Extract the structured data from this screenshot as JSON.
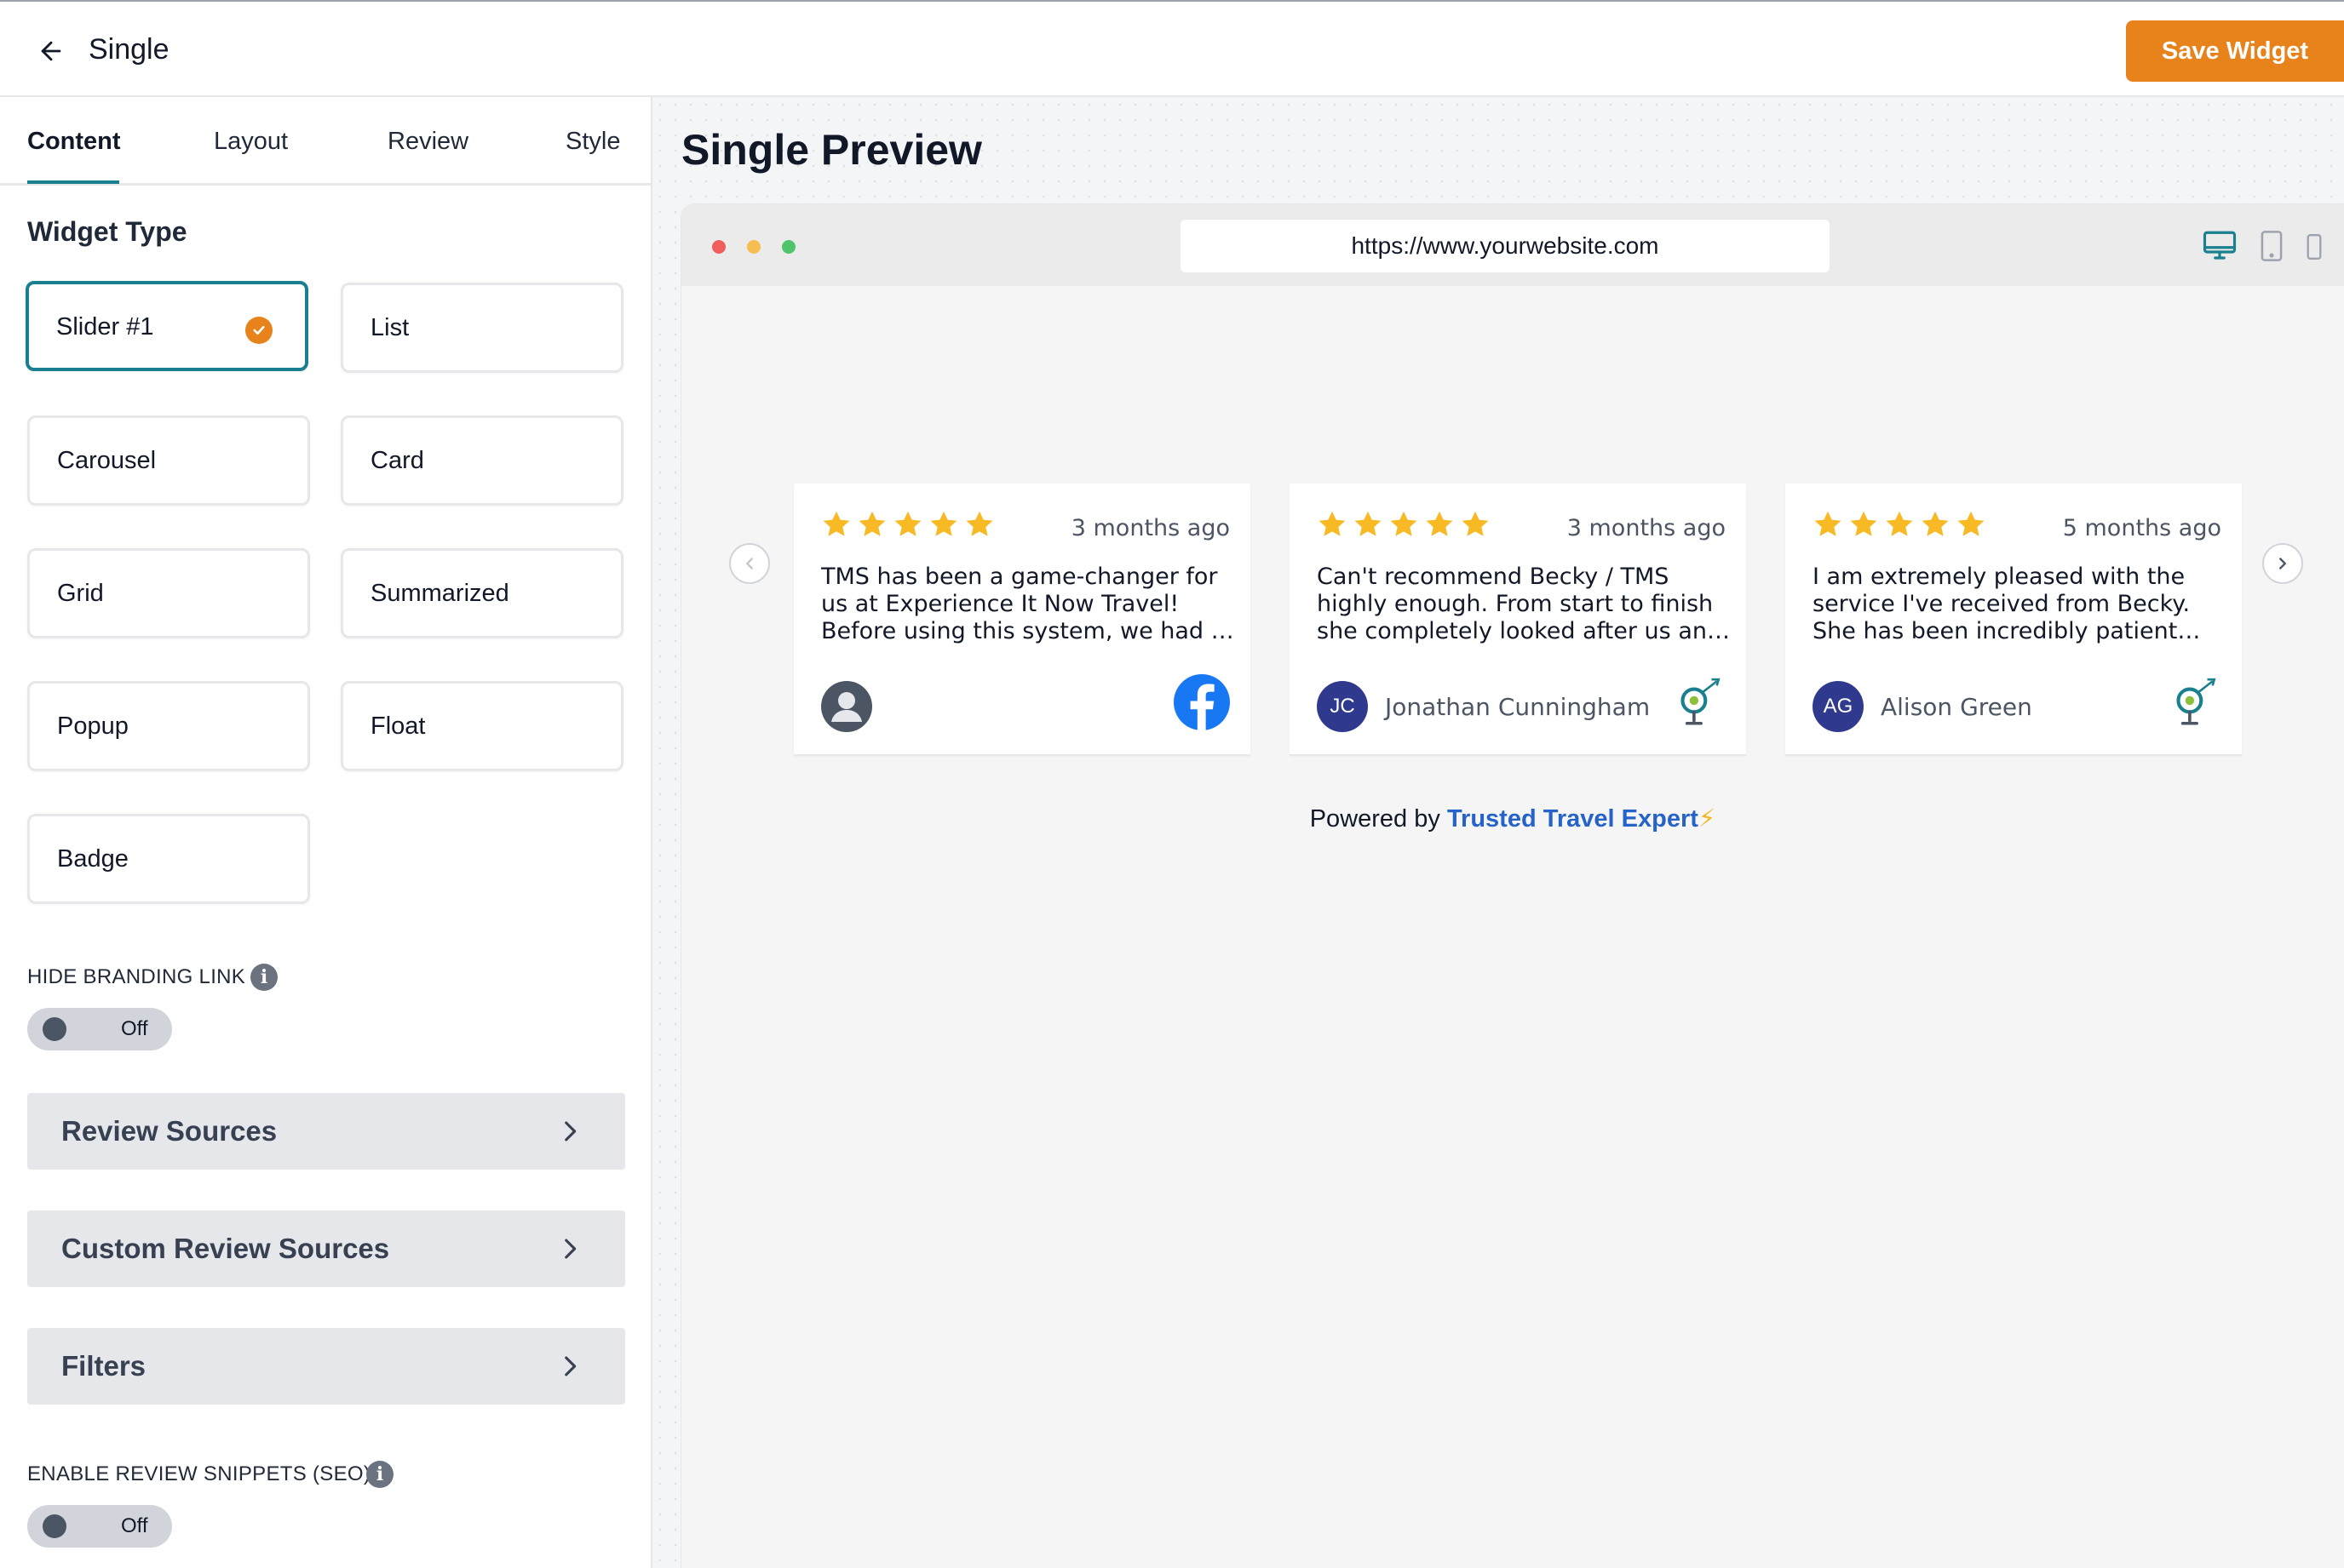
{
  "header": {
    "back_icon": "arrow-left-icon",
    "title": "Single",
    "save_label": "Save Widget"
  },
  "tabs": [
    {
      "label": "Content",
      "active": true
    },
    {
      "label": "Layout",
      "active": false
    },
    {
      "label": "Review",
      "active": false
    },
    {
      "label": "Style",
      "active": false
    }
  ],
  "widget_type": {
    "title": "Widget Type",
    "selected": "Slider #1",
    "options": [
      "Slider #1",
      "List",
      "Carousel",
      "Card",
      "Grid",
      "Summarized",
      "Popup",
      "Float",
      "Badge"
    ]
  },
  "hide_branding": {
    "label": "HIDE BRANDING LINK",
    "state": "Off"
  },
  "accordions": [
    "Review Sources",
    "Custom Review Sources",
    "Filters"
  ],
  "review_snippets": {
    "label": "ENABLE REVIEW SNIPPETS (SEO)",
    "state": "Off"
  },
  "preview": {
    "title": "Single Preview",
    "url": "https://www.yourwebsite.com",
    "devices": [
      "desktop-icon",
      "tablet-icon",
      "mobile-icon"
    ],
    "active_device": "desktop",
    "reviews": [
      {
        "rating": 5,
        "date": "3 months ago",
        "text": "TMS has been a game-changer for us at Experience It Now Travel! Before using this system, we had to manually track and manage all our bookings.",
        "initials": "",
        "name": "",
        "source_icon": "facebook-icon"
      },
      {
        "rating": 5,
        "date": "3 months ago",
        "text": "Can't recommend Becky / TMS highly enough. From start to finish she completely looked after us and made everything so easy.",
        "initials": "JC",
        "name": "Jonathan Cunningham",
        "source_icon": "trusted-travel-expert-icon"
      },
      {
        "rating": 5,
        "date": "5 months ago",
        "text": "I am extremely pleased with the service I've received from Becky. She has been incredibly patient and helpful throughout.",
        "initials": "AG",
        "name": "Alison Green",
        "source_icon": "trusted-travel-expert-icon"
      }
    ],
    "powered_prefix": "Powered by",
    "powered_brand": "Trusted Travel Expert",
    "powered_bolt": "⚡"
  },
  "colors": {
    "accent_teal": "#1a7f8e",
    "orange": "#e8821b",
    "star": "#f7b924",
    "facebook": "#1877f2",
    "link_blue": "#2563c9"
  }
}
